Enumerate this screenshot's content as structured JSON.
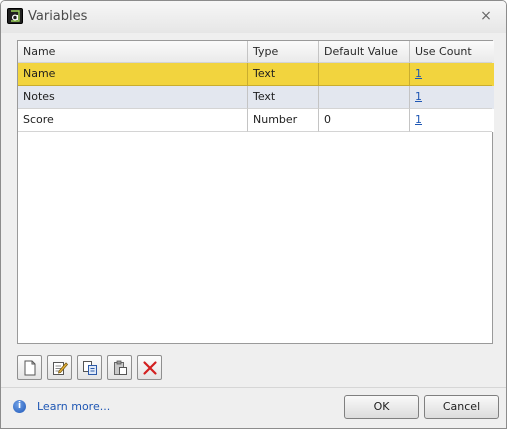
{
  "window": {
    "title": "Variables",
    "close_glyph": "×",
    "icon": "app-logo-icon"
  },
  "grid": {
    "columns": [
      "Name",
      "Type",
      "Default Value",
      "Use Count"
    ],
    "rows": [
      {
        "name": "Name",
        "type": "Text",
        "default": "",
        "use_count": "1",
        "selected": true
      },
      {
        "name": "Notes",
        "type": "Text",
        "default": "",
        "use_count": "1",
        "selected": false
      },
      {
        "name": "Score",
        "type": "Number",
        "default": "0",
        "use_count": "1",
        "selected": false
      }
    ],
    "selected_color": "#f2d43e",
    "alt_row_color": "#e3e7ef"
  },
  "toolbar": {
    "buttons": [
      "new-icon",
      "edit-icon",
      "copy-icon",
      "paste-icon",
      "delete-icon"
    ]
  },
  "footer": {
    "info_glyph": "i",
    "learn_more": "Learn more...",
    "ok": "OK",
    "cancel": "Cancel"
  }
}
